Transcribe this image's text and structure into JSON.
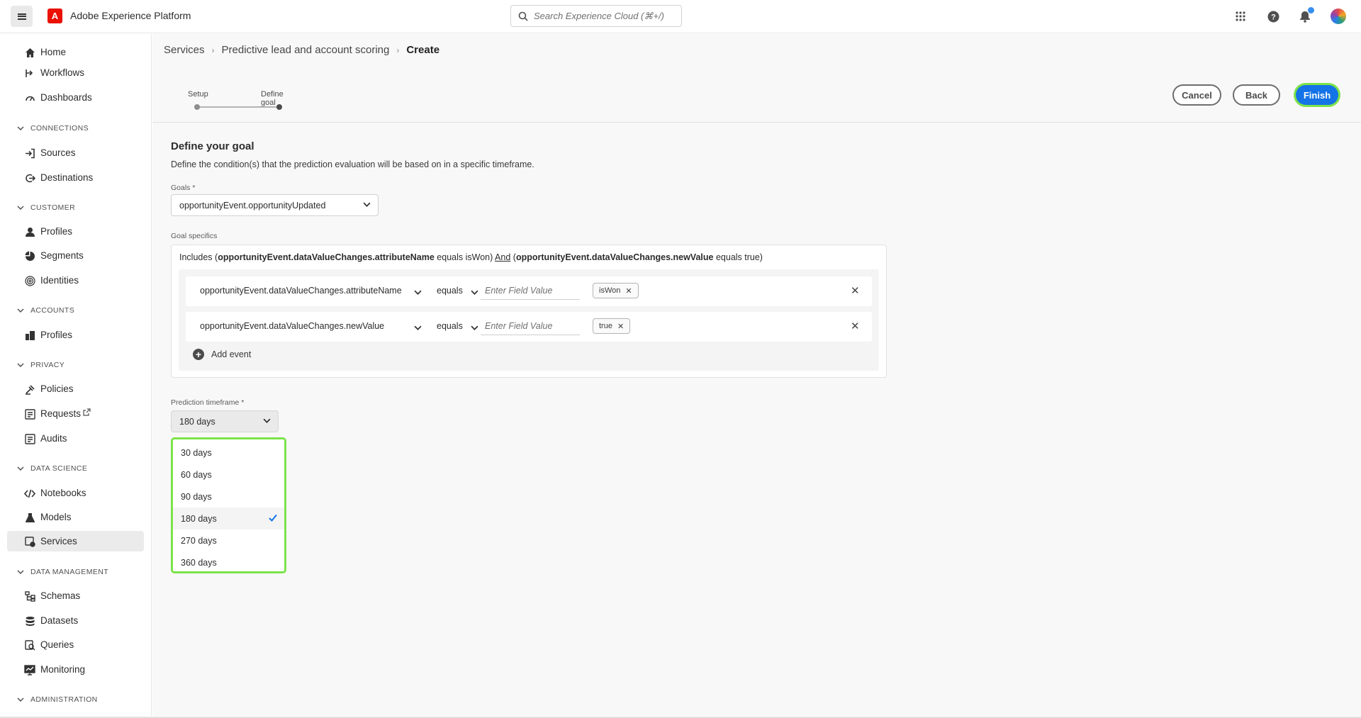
{
  "app": {
    "title": "Adobe Experience Platform"
  },
  "search": {
    "placeholder": "Search Experience Cloud (⌘+/)"
  },
  "sidebar": {
    "items": [
      {
        "label": "Home",
        "icon": "home-icon"
      },
      {
        "label": "Workflows",
        "icon": "workflow-icon"
      },
      {
        "label": "Dashboards",
        "icon": "dashboard-icon"
      },
      {
        "section": "CONNECTIONS"
      },
      {
        "label": "Sources",
        "icon": "sources-icon"
      },
      {
        "label": "Destinations",
        "icon": "destinations-icon"
      },
      {
        "section": "CUSTOMER"
      },
      {
        "label": "Profiles",
        "icon": "profile-icon"
      },
      {
        "label": "Segments",
        "icon": "segments-icon"
      },
      {
        "label": "Identities",
        "icon": "identity-icon"
      },
      {
        "section": "ACCOUNTS"
      },
      {
        "label": "Profiles",
        "icon": "account-profile-icon"
      },
      {
        "section": "PRIVACY"
      },
      {
        "label": "Policies",
        "icon": "policies-icon"
      },
      {
        "label": "Requests",
        "icon": "requests-icon"
      },
      {
        "label": "Audits",
        "icon": "audits-icon"
      },
      {
        "section": "DATA SCIENCE"
      },
      {
        "label": "Notebooks",
        "icon": "code-icon"
      },
      {
        "label": "Models",
        "icon": "beaker-icon"
      },
      {
        "label": "Services",
        "icon": "services-icon",
        "active": true
      },
      {
        "section": "DATA MANAGEMENT"
      },
      {
        "label": "Schemas",
        "icon": "schema-icon"
      },
      {
        "label": "Datasets",
        "icon": "datasets-icon"
      },
      {
        "label": "Queries",
        "icon": "queries-icon"
      },
      {
        "label": "Monitoring",
        "icon": "monitoring-icon"
      },
      {
        "section": "ADMINISTRATION"
      }
    ]
  },
  "breadcrumb": {
    "item1": "Services",
    "item2": "Predictive lead and account scoring",
    "current": "Create"
  },
  "stepper": {
    "step1": "Setup",
    "step2": "Define goal"
  },
  "actions": {
    "cancel": "Cancel",
    "back": "Back",
    "finish": "Finish"
  },
  "goal": {
    "title": "Define your goal",
    "description": "Define the condition(s) that the prediction evaluation will be based on in a specific timeframe.",
    "goals_label": "Goals *",
    "goals_value": "opportunityEvent.opportunityUpdated",
    "specifics_label": "Goal specifics",
    "includes": {
      "prefix": "Includes (",
      "attr1": "opportunityEvent.dataValueChanges.attributeName",
      "cond1": " equals isWon) ",
      "conj": "And",
      "mid": " (",
      "attr2": "opportunityEvent.dataValueChanges.newValue",
      "cond2": " equals true)"
    },
    "events": [
      {
        "attribute": "opportunityEvent.dataValueChanges.attributeName",
        "operator": "equals",
        "placeholder": "Enter Field Value",
        "tag": "isWon"
      },
      {
        "attribute": "opportunityEvent.dataValueChanges.newValue",
        "operator": "equals",
        "placeholder": "Enter Field Value",
        "tag": "true"
      }
    ],
    "add_event": "Add event"
  },
  "timeframe": {
    "label": "Prediction timeframe *",
    "value": "180 days",
    "options": [
      "30 days",
      "60 days",
      "90 days",
      "180 days",
      "270 days",
      "360 days"
    ],
    "selected_index": 3
  },
  "colors": {
    "accent": "#1473e6",
    "highlight": "#7ce34a",
    "brand": "#eb1000"
  }
}
